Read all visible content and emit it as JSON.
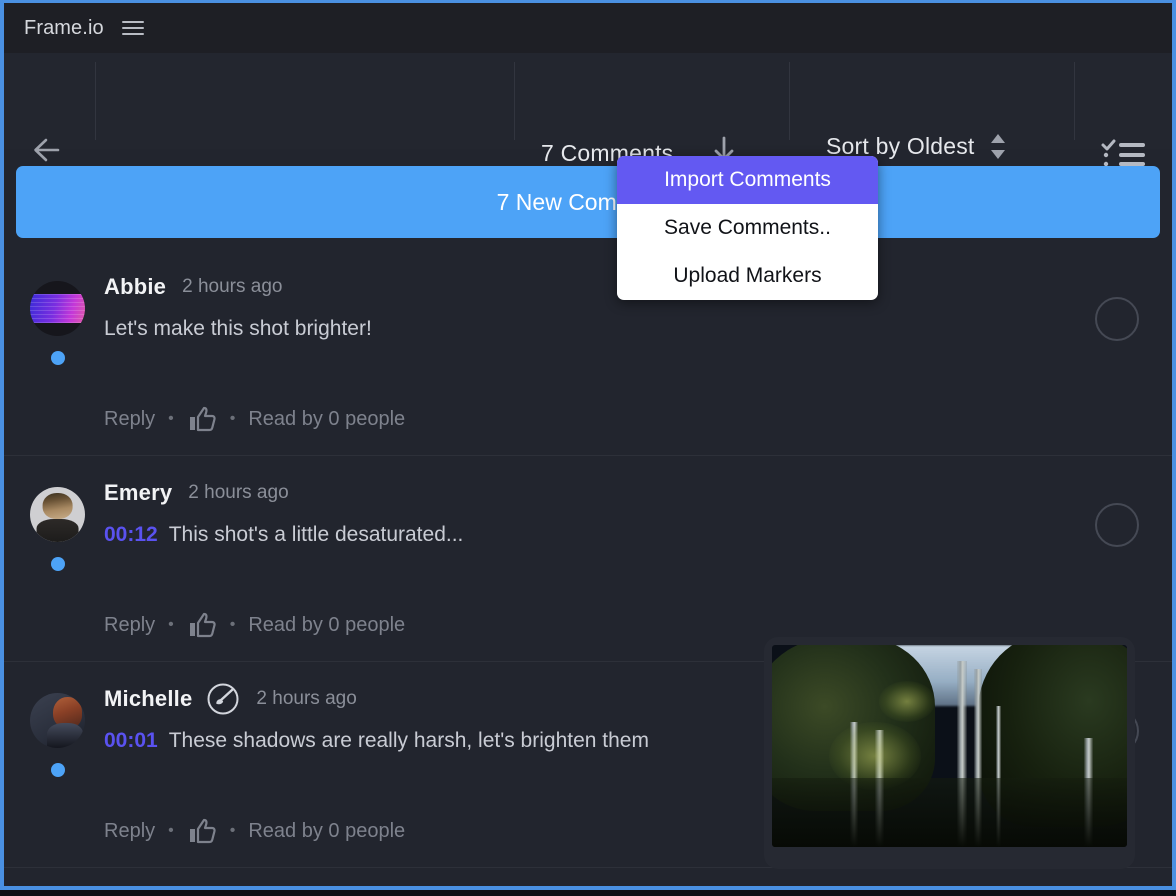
{
  "window": {
    "brand": "Frame.io",
    "menu_icon": "hamburger-icon"
  },
  "toolbar": {
    "back_icon": "back-arrow-icon",
    "comments_count": "7 Comments",
    "download_icon": "download-icon",
    "sort_label": "Sort by Oldest",
    "sort_stepper_icon": "stepper-up-down-icon",
    "checklist_icon": "checklist-icon"
  },
  "banner": {
    "label": "7 New Comments"
  },
  "menu": {
    "items": [
      {
        "label": "Import Comments",
        "selected": true
      },
      {
        "label": "Save Comments..",
        "selected": false
      },
      {
        "label": "Upload Markers",
        "selected": false
      }
    ]
  },
  "comments": [
    {
      "author": "Abbie",
      "timestamp": "2 hours ago",
      "timecode": "",
      "text": "Let's make this shot brighter!",
      "reply_label": "Reply",
      "like_icon": "thumbs-up-icon",
      "read_label": "Read by 0 people",
      "badge": "",
      "avatar": "abbie-avatar"
    },
    {
      "author": "Emery",
      "timestamp": "2 hours ago",
      "timecode": "00:12",
      "text": "This shot's a little desaturated...",
      "reply_label": "Reply",
      "like_icon": "thumbs-up-icon",
      "read_label": "Read by 0 people",
      "badge": "",
      "avatar": "emery-avatar"
    },
    {
      "author": "Michelle",
      "timestamp": "2 hours ago",
      "timecode": "00:01",
      "text": "These shadows are really harsh, let's brighten them",
      "reply_label": "Reply",
      "like_icon": "thumbs-up-icon",
      "read_label": "Read by 0 people",
      "badge": "paintbrush-badge-icon",
      "avatar": "michelle-avatar"
    }
  ],
  "thumbnail": {
    "alt": "dark-forest-frame"
  },
  "colors": {
    "accent_blue": "#4da3f7",
    "accent_purple": "#6359f2",
    "timecode_purple": "#5a52f0",
    "panel_bg": "#22252e",
    "toolbar_bg": "#23262f",
    "titlebar_bg": "#1e1f25",
    "focus_border": "#4a90e2"
  }
}
